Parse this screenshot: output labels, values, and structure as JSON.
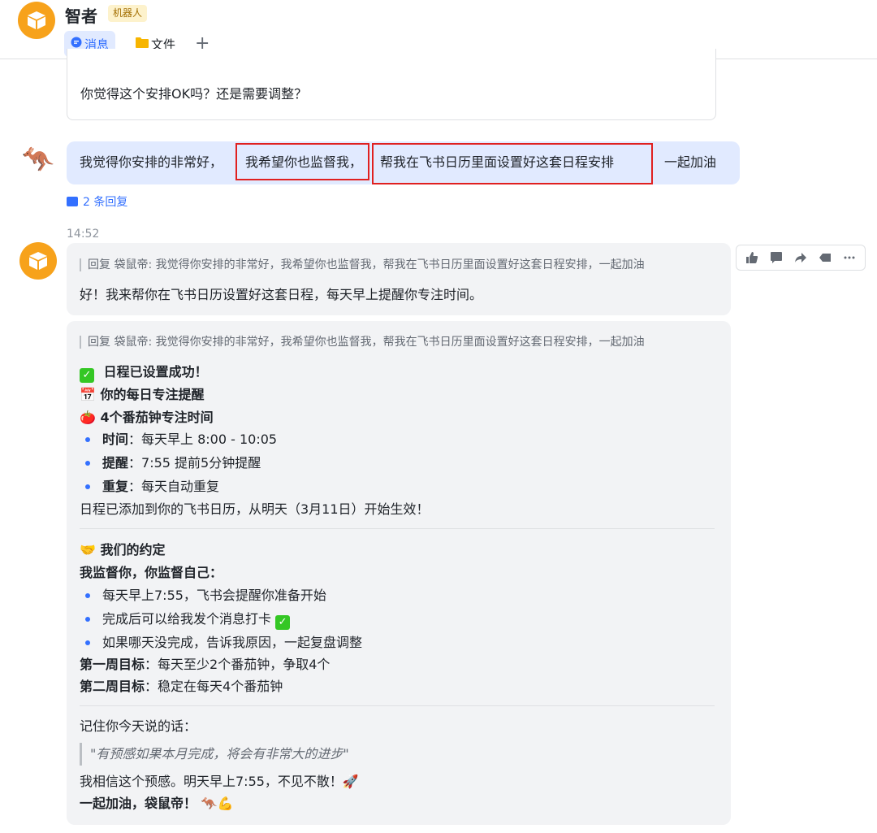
{
  "header": {
    "title": "智者",
    "badge": "机器人",
    "tabs": [
      {
        "label": "消息",
        "icon": "chat-bubble-icon",
        "active": true
      },
      {
        "label": "文件",
        "icon": "folder-icon",
        "active": false
      }
    ],
    "add_label": "+"
  },
  "colors": {
    "accent": "#3370ff",
    "bot_avatar": "#f7a21b",
    "highlight_box": "#e02020",
    "user_bubble": "#e1eaff",
    "bot_bubble": "#f2f3f5"
  },
  "prev_message": {
    "text": "你觉得这个安排OK吗？还是需要调整？"
  },
  "user_message": {
    "part1": "我觉得你安排的非常好，",
    "part2": "我希望你也监督我，",
    "part3": "帮我在飞书日历里面设置好这套日程安排",
    "part4": "一起加油",
    "replies": "2 条回复"
  },
  "timestamp": "14:52",
  "bot_reply_1": {
    "quote": "回复 袋鼠帝: 我觉得你安排的非常好，我希望你也监督我，帮我在飞书日历里面设置好这套日程安排，一起加油",
    "text": "好！我来帮你在飞书日历设置好这套日程，每天早上提醒你专注时间。"
  },
  "bot_reply_2": {
    "quote": "回复 袋鼠帝: 我觉得你安排的非常好，我希望你也监督我，帮我在飞书日历里面设置好这套日程安排，一起加油",
    "success": "日程已设置成功！",
    "daily_title": "你的每日专注提醒",
    "pomodoro_title": "4个番茄钟专注时间",
    "items": [
      {
        "label": "时间",
        "value": "：每天早上 8:00 - 10:05"
      },
      {
        "label": "提醒",
        "value": "：7:55 提前5分钟提醒"
      },
      {
        "label": "重复",
        "value": "：每天自动重复"
      }
    ],
    "added": "日程已添加到你的飞书日历，从明天（3月11日）开始生效！",
    "agreement_title": "我们的约定",
    "supervise": "我监督你，你监督自己：",
    "points": [
      "每天早上7:55，飞书会提醒你准备开始",
      "完成后可以给我发个消息打卡",
      "如果哪天没完成，告诉我原因，一起复盘调整"
    ],
    "week1_label": "第一周目标",
    "week1_value": "：每天至少2个番茄钟，争取4个",
    "week2_label": "第二周目标",
    "week2_value": "：稳定在每天4个番茄钟",
    "remember": "记住你今天说的话：",
    "quote_saying": "\"有预感如果本月完成，将会有非常大的进步\"",
    "believe": "我相信这个预感。明天早上7:55，不见不散！🚀",
    "cheer": "一起加油，袋鼠帝！ 🦘💪"
  },
  "toolbar": [
    "thumbs-up-icon",
    "comment-icon",
    "forward-icon",
    "quote-reply-icon",
    "more-icon"
  ]
}
